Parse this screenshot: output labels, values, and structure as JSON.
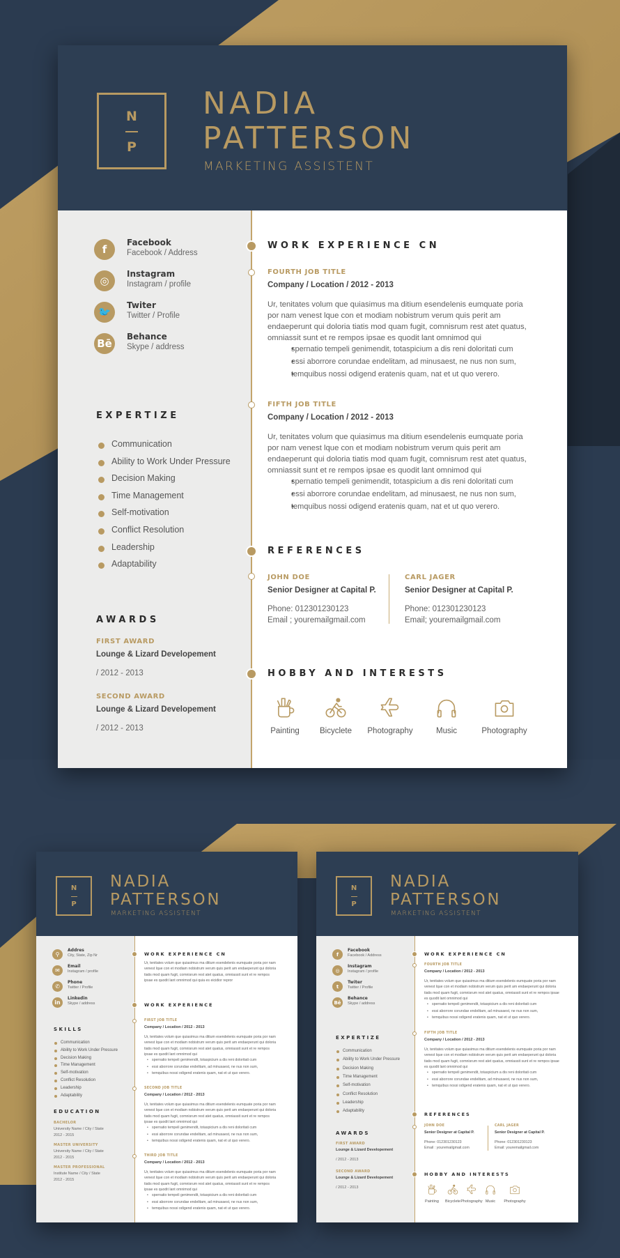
{
  "colors": {
    "navy": "#2d3e53",
    "gold": "#b89a62",
    "sidebar": "#ececeb",
    "background": "#2b3b50"
  },
  "main": {
    "monogram": {
      "top": "N",
      "bottom": "P"
    },
    "name_line1": "NADIA",
    "name_line2": "PATTERSON",
    "role": "MARKETING ASSISTENT",
    "contacts": [
      {
        "icon": "facebook-icon",
        "glyph": "f",
        "label": "Facebook",
        "value": "Facebook / Address"
      },
      {
        "icon": "instagram-icon",
        "glyph": "◎",
        "label": "Instagram",
        "value": "Instagram / profile"
      },
      {
        "icon": "twitter-icon",
        "glyph": "🐦",
        "label": "Twiter",
        "value": "Twitter / Profile"
      },
      {
        "icon": "behance-icon",
        "glyph": "Bē",
        "label": "Behance",
        "value": "Skype / address"
      }
    ],
    "expertize_title": "EXPERTIZE",
    "expertize": [
      "Communication",
      "Ability to Work Under Pressure",
      "Decision Making",
      "Time Management",
      "Self-motivation",
      "Conflict Resolution",
      "Leadership",
      "Adaptability"
    ],
    "awards_title": "AWARDS",
    "awards": [
      {
        "title": "FIRST AWARD",
        "org": "Lounge & Lizard Developement",
        "date": "/ 2012 - 2013"
      },
      {
        "title": "SECOND AWARD",
        "org": "Lounge & Lizard Developement",
        "date": "/ 2012 - 2013"
      }
    ],
    "work_title": "WORK EXPERIENCE CN",
    "jobs": [
      {
        "title": "FOURTH JOB TITLE",
        "company": "Company / Location / 2012 - 2013",
        "description": "Ur, tenitates volum que quiasimus ma ditium esendelenis eumquate poria por nam venest lque con et modiam nobistrum verum quis perit am endaeperunt qui doloria tiatis mod quam fugit, comnisrum rest atet quatus, omniassit sunt et re rempos ipsae es quodit lant omnimod qui",
        "bullets": [
          "spernatio tempeli genimendit, totaspicium a dis reni doloritati cum",
          "essi aborrore corundae endelitam, ad minusaest, ne nus non sum,",
          "temquibus nossi odigend eratenis quam, nat et ut quo verero."
        ]
      },
      {
        "title": "FIFTH JOB TITLE",
        "company": "Company / Location / 2012 - 2013",
        "description": "Ur, tenitates volum que quiasimus ma ditium esendelenis eumquate poria por nam venest lque con et modiam nobistrum verum quis perit am endaeperunt qui doloria tiatis mod quam fugit, comnisrum rest atet quatus, omniassit sunt et re rempos ipsae es quodit lant omnimod qui",
        "bullets": [
          "spernatio tempeli genimendit, totaspicium a dis reni doloritati cum",
          "essi aborrore corundae endelitam, ad minusaest, ne nus non sum,",
          "temquibus nossi odigend eratenis quam, nat et ut quo verero."
        ]
      }
    ],
    "references_title": "REFERENCES",
    "references": [
      {
        "name": "JOHN DOE",
        "position": "Senior Designer at Capital P.",
        "phone": "Phone: 012301230123",
        "email": "Email ; youremailgmail.com"
      },
      {
        "name": "CARL JAGER",
        "position": "Senior Designer at Capital P.",
        "phone": "Phone: 012301230123",
        "email": "Email; youremailgmail.com"
      }
    ],
    "hobbies_title": "HOBBY AND INTERESTS",
    "hobbies": [
      {
        "icon": "painting-icon",
        "label": "Painting"
      },
      {
        "icon": "bicycle-icon",
        "label": "Bicyclete"
      },
      {
        "icon": "airplane-icon",
        "label": "Photography"
      },
      {
        "icon": "headphones-icon",
        "label": "Music"
      },
      {
        "icon": "camera-icon",
        "label": "Photography"
      }
    ]
  },
  "thumb_left": {
    "monogram": {
      "top": "N",
      "bottom": "P"
    },
    "name_line1": "NADIA",
    "name_line2": "PATTERSON",
    "role": "MARKETING ASSISTENT",
    "contacts": [
      {
        "icon": "location-icon",
        "label": "Addres",
        "value": "City, State, Zip Nr"
      },
      {
        "icon": "email-icon",
        "label": "Email",
        "value": "Instagram / profile"
      },
      {
        "icon": "phone-icon",
        "label": "Phone",
        "value": "Twitter / Profile"
      },
      {
        "icon": "linkedin-icon",
        "label": "Linkedin",
        "value": "Skype / address"
      }
    ],
    "skills_title": "SKILLS",
    "skills": [
      "Communication",
      "Ability to Work Under Pressure",
      "Decision Making",
      "Time Management",
      "Self-motivation",
      "Conflict Resolution",
      "Leadership",
      "Adaptability"
    ],
    "education_title": "EDUCATION",
    "education": [
      {
        "title": "BACHELOR",
        "place": "University Name / City / State",
        "date": "2012 - 2015"
      },
      {
        "title": "MASTER UNIVERSITY",
        "place": "University Name / City / State",
        "date": "2012 - 2015"
      },
      {
        "title": "MASTER PROFESSIONAL",
        "place": "Institute Name / City / State",
        "date": "2012 - 2015"
      }
    ],
    "summary_title": "WORK EXPERIENCE CN",
    "summary": "Ur, tenitates volum que quiasimus ma ditium esendelenis eumquate poria por nam venest lque con et modiam nobistrum verum quis perit am endaeperunt qui doloria tiatis mod quam fugit, comnisrum rest atet quatus, omniassit sunt et re rempos ipsae es quodit lant omnimod qui quia es eicidior repror",
    "work_title": "WORK EXPERIENCE",
    "jobs": [
      {
        "title": "FIRST JOB TITLE",
        "company": "Company / Location / 2012 - 2013"
      },
      {
        "title": "SECOND JOB TITLE",
        "company": "Company / Location / 2012 - 2013"
      },
      {
        "title": "THIRD JOB TITLE",
        "company": "Company / Location / 2012 - 2013"
      }
    ],
    "job_description": "Ur, tenitates volum que quiasimus ma ditium esendelenis eumquate poria por nam venest lque con et modiam nobistrum verum quis perit am endaeperunt qui doloria tiatis mod quam fugit, comnisrum rest atet quatus, omniassit sunt et re rempos ipsae es quodit lant omnimod qui",
    "job_bullets": [
      "spernatio tempeli genimendit, totaspicium a dis reni doloritati cum",
      "essi aborrore corundae endelitam, ad minusaest, ne nus non sum,",
      "temquibus nossi odigend eratenis quam, nat et ut quo verero."
    ]
  },
  "thumb_right": {
    "monogram": {
      "top": "N",
      "bottom": "P"
    },
    "name_line1": "NADIA",
    "name_line2": "PATTERSON",
    "role": "MARKETING ASSISTENT",
    "contacts": [
      {
        "icon": "facebook-icon",
        "glyph": "f",
        "label": "Facebook",
        "value": "Facebook / Address"
      },
      {
        "icon": "instagram-icon",
        "glyph": "◎",
        "label": "Instagram",
        "value": "Instagram / profile"
      },
      {
        "icon": "twitter-icon",
        "glyph": "t",
        "label": "Twiter",
        "value": "Twitter / Profile"
      },
      {
        "icon": "behance-icon",
        "glyph": "Bē",
        "label": "Behance",
        "value": "Skype / address"
      }
    ],
    "expertize_title": "EXPERTIZE",
    "expertize": [
      "Communication",
      "Ability to Work Under Pressure",
      "Decision Making",
      "Time Management",
      "Self-motivation",
      "Conflict Resolution",
      "Leadership",
      "Adaptability"
    ],
    "awards_title": "AWARDS",
    "awards": [
      {
        "title": "FIRST AWARD",
        "org": "Lounge & Lizard Developement",
        "date": "/ 2012 - 2013"
      },
      {
        "title": "SECOND AWARD",
        "org": "Lounge & Lizard Developement",
        "date": "/ 2012 - 2013"
      }
    ],
    "work_title": "WORK EXPERIENCE CN",
    "jobs": [
      {
        "title": "FOURTH JOB TITLE",
        "company": "Company / Location / 2012 - 2013"
      },
      {
        "title": "FIFTH JOB TITLE",
        "company": "Company / Location / 2012 - 2013"
      }
    ],
    "job_description": "Ur, tenitates volum que quiasimus ma ditium esendelenis eumquate poria por nam venest lque con et modiam nobistrum verum quis perit am endaeperunt qui doloria tiatis mod quam fugit, comnisrum rest atet quatus, omniassit sunt et re rempos ipsae es quodit lant omnimod qui",
    "job_bullets": [
      "spernatio tempeli genimendit, totaspicium a dis reni doloritati cum",
      "essi aborrore corundae endelitam, ad minusaest, ne nus non sum,",
      "temquibus nossi odigend eratenis quam, nat et ut quo verero."
    ],
    "references_title": "REFERENCES",
    "references": [
      {
        "name": "JOHN DOE",
        "position": "Senior Designer at Capital P.",
        "phone": "Phone: 012301230123",
        "email": "Email : youremailgmail.com"
      },
      {
        "name": "CARL JAGER",
        "position": "Senior Designer at Capital P.",
        "phone": "Phone: 012301230123",
        "email": "Email: youremailgmail.com"
      }
    ],
    "hobbies_title": "HOBBY AND INTERESTS",
    "hobbies": [
      "Painting",
      "Bicyclete",
      "Photography",
      "Music",
      "Photography"
    ]
  }
}
